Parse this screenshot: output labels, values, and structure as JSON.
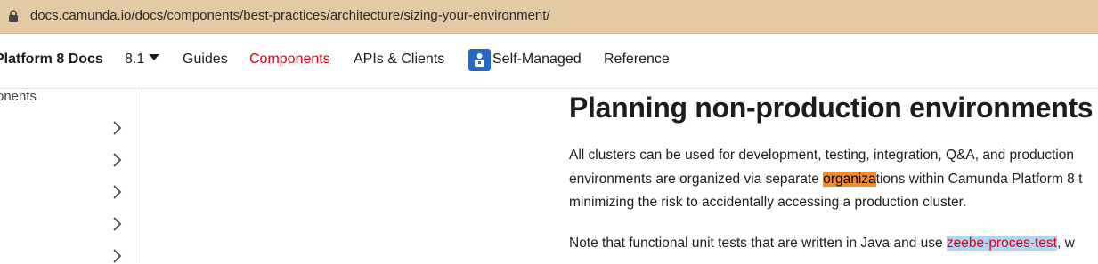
{
  "browser": {
    "url": "docs.camunda.io/docs/components/best-practices/architecture/sizing-your-environment/"
  },
  "navbar": {
    "brand": "Platform 8 Docs",
    "version": "8.1",
    "items": [
      {
        "label": "Guides"
      },
      {
        "label": "Components",
        "active": true
      },
      {
        "label": "APIs & Clients"
      },
      {
        "label": "Self-Managed"
      },
      {
        "label": "Reference"
      }
    ]
  },
  "sidebar": {
    "label": "onents"
  },
  "article": {
    "heading": "Planning non-production environments",
    "p1_line1": "All clusters can be used for development, testing, integration, Q&A, and production",
    "p1_line2_pre": "environments are organized via separate ",
    "p1_line2_highlight": "organiza",
    "p1_line2_post": "tions within Camunda Platform 8 t",
    "p1_line3": "minimizing the risk to accidentally accessing a production cluster.",
    "p2_pre": "Note that functional unit tests that are written in Java and use ",
    "p2_link": "zeebe-proces-test",
    "p2_post": ", w"
  },
  "colors": {
    "urlbar_bg": "#e3c9a4",
    "active_nav": "#e0000e",
    "highlight": "#f38b2e",
    "selection": "#b3d4f5"
  }
}
